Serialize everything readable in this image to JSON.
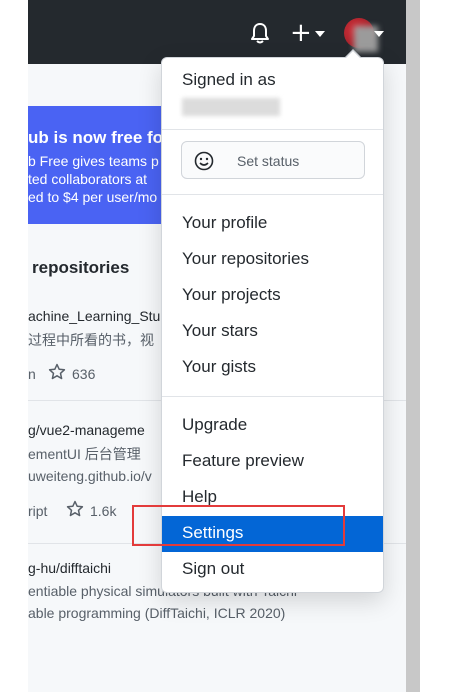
{
  "topnav": {
    "bell_icon": "bell-icon",
    "plus_symbol": "+",
    "avatar_icon": "avatar"
  },
  "banner": {
    "title": "ub is now free for",
    "lines": [
      "b Free gives teams p",
      "ted collaborators at",
      "ed to $4 per user/mo"
    ]
  },
  "repositories": {
    "heading": "repositories",
    "items": [
      {
        "name": "achine_Learning_Stu",
        "desc": "过程中所看的书，视",
        "lang": "n",
        "stars": "636"
      },
      {
        "name": "g/vue2-manageme",
        "desc": "ementUI 后台管理",
        "extra": "uweiteng.github.io/v",
        "lang": "ript",
        "stars": "1.6k"
      },
      {
        "name": "g-hu/difftaichi",
        "desc": "entiable physical simulators built with Taichi",
        "extra": "able programming (DiffTaichi, ICLR 2020)"
      }
    ]
  },
  "dropdown": {
    "signed_in_as": "Signed in as",
    "set_status": "Set status",
    "items": [
      {
        "label": "Your profile"
      },
      {
        "label": "Your repositories"
      },
      {
        "label": "Your projects"
      },
      {
        "label": "Your stars"
      },
      {
        "label": "Your gists"
      },
      {
        "label": "Upgrade"
      },
      {
        "label": "Feature preview"
      },
      {
        "label": "Help"
      },
      {
        "label": "Settings",
        "active": true
      },
      {
        "label": "Sign out"
      }
    ]
  },
  "colors": {
    "header_bg": "#24292e",
    "banner_bg": "#4a63f3",
    "active_item_bg": "#0366d6",
    "highlight_border": "#e33b3b"
  }
}
